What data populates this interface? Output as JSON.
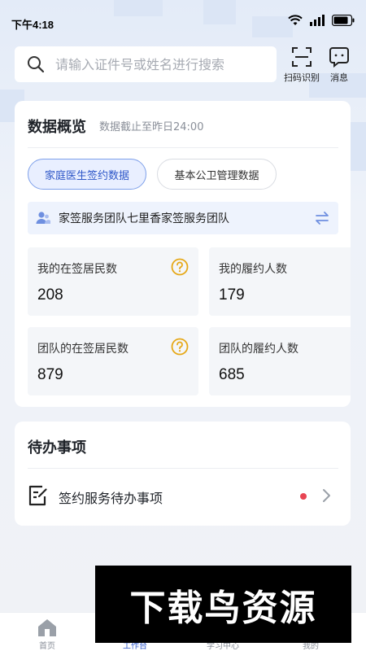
{
  "status_bar": {
    "time": "下午4:18"
  },
  "search": {
    "placeholder": "请输入证件号或姓名进行搜索"
  },
  "top_actions": {
    "scan_label": "扫码识别",
    "message_label": "消息"
  },
  "overview": {
    "title": "数据概览",
    "subtitle": "数据截止至昨日24:00",
    "tabs": [
      {
        "label": "家庭医生签约数据",
        "active": true
      },
      {
        "label": "基本公卫管理数据",
        "active": false
      }
    ],
    "team": "家签服务团队七里香家签服务团队",
    "stats": [
      {
        "label": "我的在签居民数",
        "value": "208",
        "help": true
      },
      {
        "label": "我的履约人数",
        "value": "179",
        "help": false
      },
      {
        "label": "团队的在签居民数",
        "value": "879",
        "help": true
      },
      {
        "label": "团队的履约人数",
        "value": "685",
        "help": false
      }
    ]
  },
  "todo": {
    "title": "待办事项",
    "items": [
      {
        "label": "签约服务待办事项",
        "has_badge": true
      }
    ]
  },
  "tabbar": {
    "tabs": [
      {
        "label": "首页",
        "icon": "home-icon",
        "active": false
      },
      {
        "label": "工作台",
        "icon": "workbench-icon",
        "active": true
      },
      {
        "label": "学习中心",
        "icon": "study-icon",
        "active": false
      },
      {
        "label": "我的",
        "icon": "profile-icon",
        "active": false
      }
    ]
  },
  "watermark": {
    "text": "下载鸟资源"
  },
  "colors": {
    "accent": "#2e57c8",
    "badge": "#e84553",
    "help": "#e6a817",
    "stat_bg": "#f4f6f9"
  }
}
